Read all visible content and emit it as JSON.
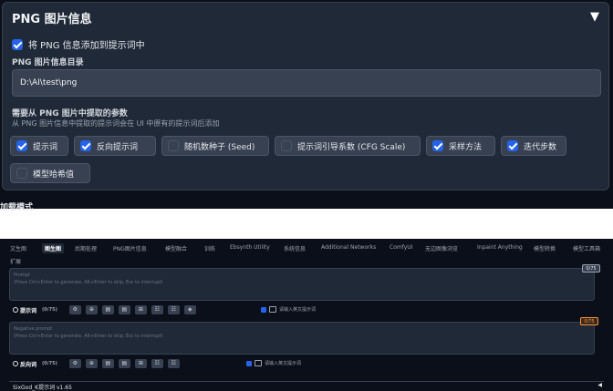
{
  "png_panel": {
    "title": "PNG 图片信息",
    "add_to_prompt_label": "将 PNG 信息添加到提示词中",
    "add_to_prompt_checked": true,
    "dir_label": "PNG 图片信息目录",
    "dir_value": "D:\\AI\\test\\png",
    "params_title": "需要从 PNG 图片中提取的参数",
    "params_subtitle": "从 PNG 图片信息中提取的提示词会在 UI 中原有的提示词后添加",
    "params": [
      {
        "label": "提示词",
        "checked": true
      },
      {
        "label": "反向提示词",
        "checked": true
      },
      {
        "label": "随机数种子 (Seed)",
        "checked": false
      },
      {
        "label": "提示词引导系数 (CFG Scale)",
        "checked": false
      },
      {
        "label": "采样方法",
        "checked": true
      },
      {
        "label": "迭代步数",
        "checked": true
      },
      {
        "label": "模型哈希值",
        "checked": false
      }
    ]
  },
  "mode_label": "加载模式",
  "webui": {
    "tabs": [
      "文生图",
      "图生图",
      "后期处理",
      "PNG图片信息",
      "模型融合",
      "训练",
      "Ebsynth Utility",
      "系统信息",
      "Additional Networks",
      "ComfyUI",
      "无边图像浏览",
      "Inpaint Anything",
      "模型转换",
      "模型工具箱"
    ],
    "active_tab": 1,
    "extra_tab": "扩展",
    "prompt": {
      "title": "Prompt",
      "placeholder": "(Press Ctrl+Enter to generate, Alt+Enter to skip, Esc to interrupt)",
      "counter": "0/75",
      "label": "提示词",
      "count": "(0/75)",
      "check_label": "请输入英文提示词"
    },
    "negative": {
      "title": "Negative prompt",
      "placeholder": "(Press Ctrl+Enter to generate, Alt+Enter to skip, Esc to interrupt)",
      "counter": "0/75",
      "label": "反向词",
      "count": "(0/75)",
      "check_label": "请输入英文提示词"
    },
    "ctrl_buttons_prompt": [
      "⚙",
      "⊕",
      "▤",
      "▤",
      "⊞",
      "☷",
      "☷",
      "◈"
    ],
    "ctrl_buttons_negative": [
      "⚙",
      "⊕",
      "▤",
      "▤",
      "⊞",
      "☷",
      "☷"
    ],
    "model_label": "SixGod_K提示词 v1.65",
    "model_arrow": "◀"
  },
  "colors": {
    "accent": "#2563eb",
    "panel": "#1f2937",
    "background": "#0b0f19"
  }
}
